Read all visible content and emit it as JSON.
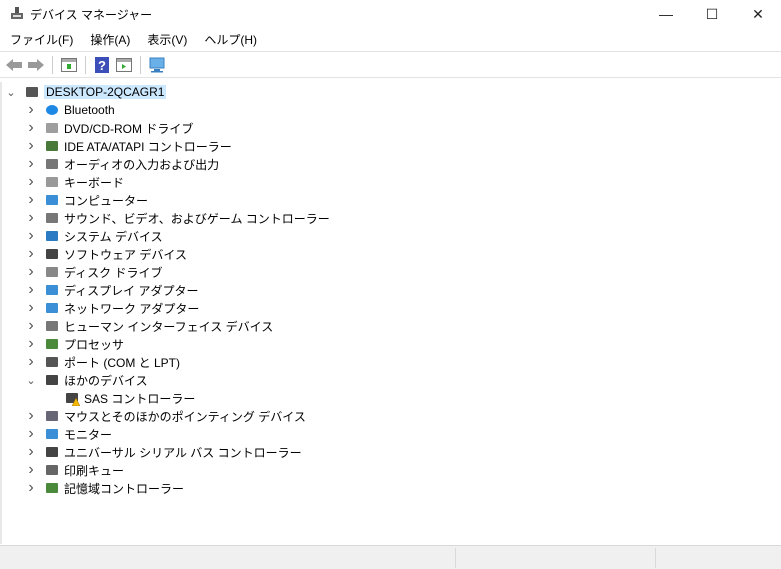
{
  "window": {
    "title": "デバイス マネージャー",
    "minimize": "—",
    "maximize": "☐",
    "close": "✕"
  },
  "menu": [
    "ファイル(F)",
    "操作(A)",
    "表示(V)",
    "ヘルプ(H)"
  ],
  "toolbar": [
    "back-icon",
    "forward-icon",
    "properties-icon",
    "help-icon",
    "update-driver-icon",
    "scan-hardware-icon"
  ],
  "tree": {
    "root": "DESKTOP-2QCAGR1",
    "items": [
      {
        "label": "Bluetooth",
        "icon": "bluetooth-icon",
        "color": "#1e88e5"
      },
      {
        "label": "DVD/CD-ROM ドライブ",
        "icon": "dvd-drive-icon",
        "color": "#9e9e9e"
      },
      {
        "label": "IDE ATA/ATAPI コントローラー",
        "icon": "ide-controller-icon",
        "color": "#4a7a3a"
      },
      {
        "label": "オーディオの入力および出力",
        "icon": "speaker-icon",
        "color": "#777"
      },
      {
        "label": "キーボード",
        "icon": "keyboard-icon",
        "color": "#999"
      },
      {
        "label": "コンピューター",
        "icon": "computer-icon",
        "color": "#3a8fd6"
      },
      {
        "label": "サウンド、ビデオ、およびゲーム コントローラー",
        "icon": "sound-icon",
        "color": "#777"
      },
      {
        "label": "システム デバイス",
        "icon": "system-device-icon",
        "color": "#2b7bc4"
      },
      {
        "label": "ソフトウェア デバイス",
        "icon": "software-device-icon",
        "color": "#444"
      },
      {
        "label": "ディスク ドライブ",
        "icon": "disk-drive-icon",
        "color": "#888"
      },
      {
        "label": "ディスプレイ アダプター",
        "icon": "display-adapter-icon",
        "color": "#3a8fd6"
      },
      {
        "label": "ネットワーク アダプター",
        "icon": "network-adapter-icon",
        "color": "#3a8fd6"
      },
      {
        "label": "ヒューマン インターフェイス デバイス",
        "icon": "hid-icon",
        "color": "#777"
      },
      {
        "label": "プロセッサ",
        "icon": "processor-icon",
        "color": "#4a8a3a"
      },
      {
        "label": "ポート (COM と LPT)",
        "icon": "port-icon",
        "color": "#555"
      },
      {
        "label": "ほかのデバイス",
        "icon": "other-devices-icon",
        "color": "#444",
        "expanded": true,
        "children": [
          {
            "label": "SAS コントローラー",
            "icon": "warning-device-icon",
            "color": "#f2b705"
          }
        ]
      },
      {
        "label": "マウスとそのほかのポインティング デバイス",
        "icon": "mouse-icon",
        "color": "#667"
      },
      {
        "label": "モニター",
        "icon": "monitor-icon",
        "color": "#3a8fd6"
      },
      {
        "label": "ユニバーサル シリアル バス コントローラー",
        "icon": "usb-icon",
        "color": "#444"
      },
      {
        "label": "印刷キュー",
        "icon": "printer-icon",
        "color": "#666"
      },
      {
        "label": "記憶域コントローラー",
        "icon": "storage-controller-icon",
        "color": "#4a8a3a"
      }
    ]
  }
}
